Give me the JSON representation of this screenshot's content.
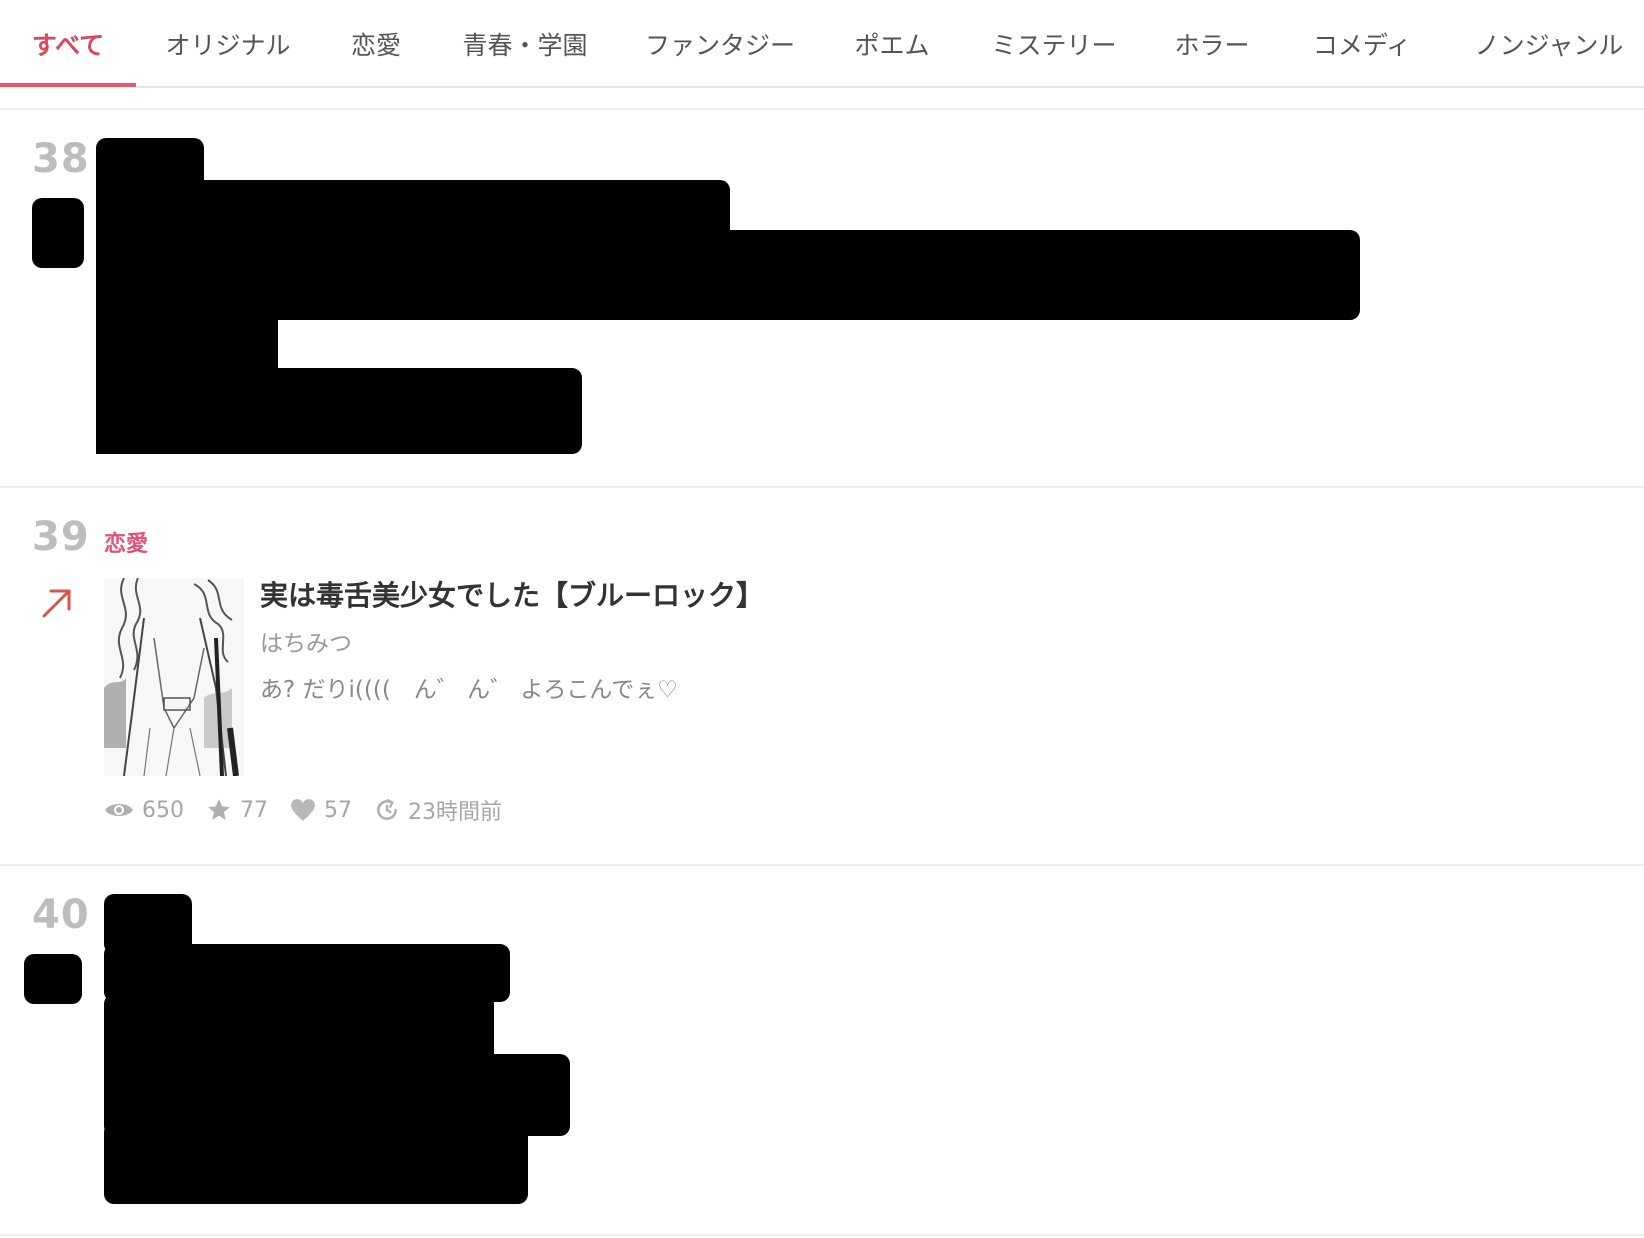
{
  "tabs": [
    {
      "label": "すべて",
      "active": true
    },
    {
      "label": "オリジナル"
    },
    {
      "label": "恋愛"
    },
    {
      "label": "青春・学園"
    },
    {
      "label": "ファンタジー"
    },
    {
      "label": "ポエム"
    },
    {
      "label": "ミステリー"
    },
    {
      "label": "ホラー"
    },
    {
      "label": "コメディ"
    },
    {
      "label": "ノンジャンル"
    }
  ],
  "entries": [
    {
      "rank": "38",
      "censored": true
    },
    {
      "rank": "39",
      "genre": "恋愛",
      "trend": "up",
      "title": "実は毒舌美少女でした【ブルーロック】",
      "author": "はちみつ",
      "excerpt": "あ? だりi((((　ん゛ ん゛ よろこんでぇ♡",
      "stats": {
        "views": "650",
        "stars": "77",
        "likes": "57",
        "updated": "23時間前"
      }
    },
    {
      "rank": "40",
      "censored": true
    }
  ],
  "colors": {
    "accent": "#e05a6e",
    "genre": "#e0537a",
    "trend": "#d9534f"
  }
}
